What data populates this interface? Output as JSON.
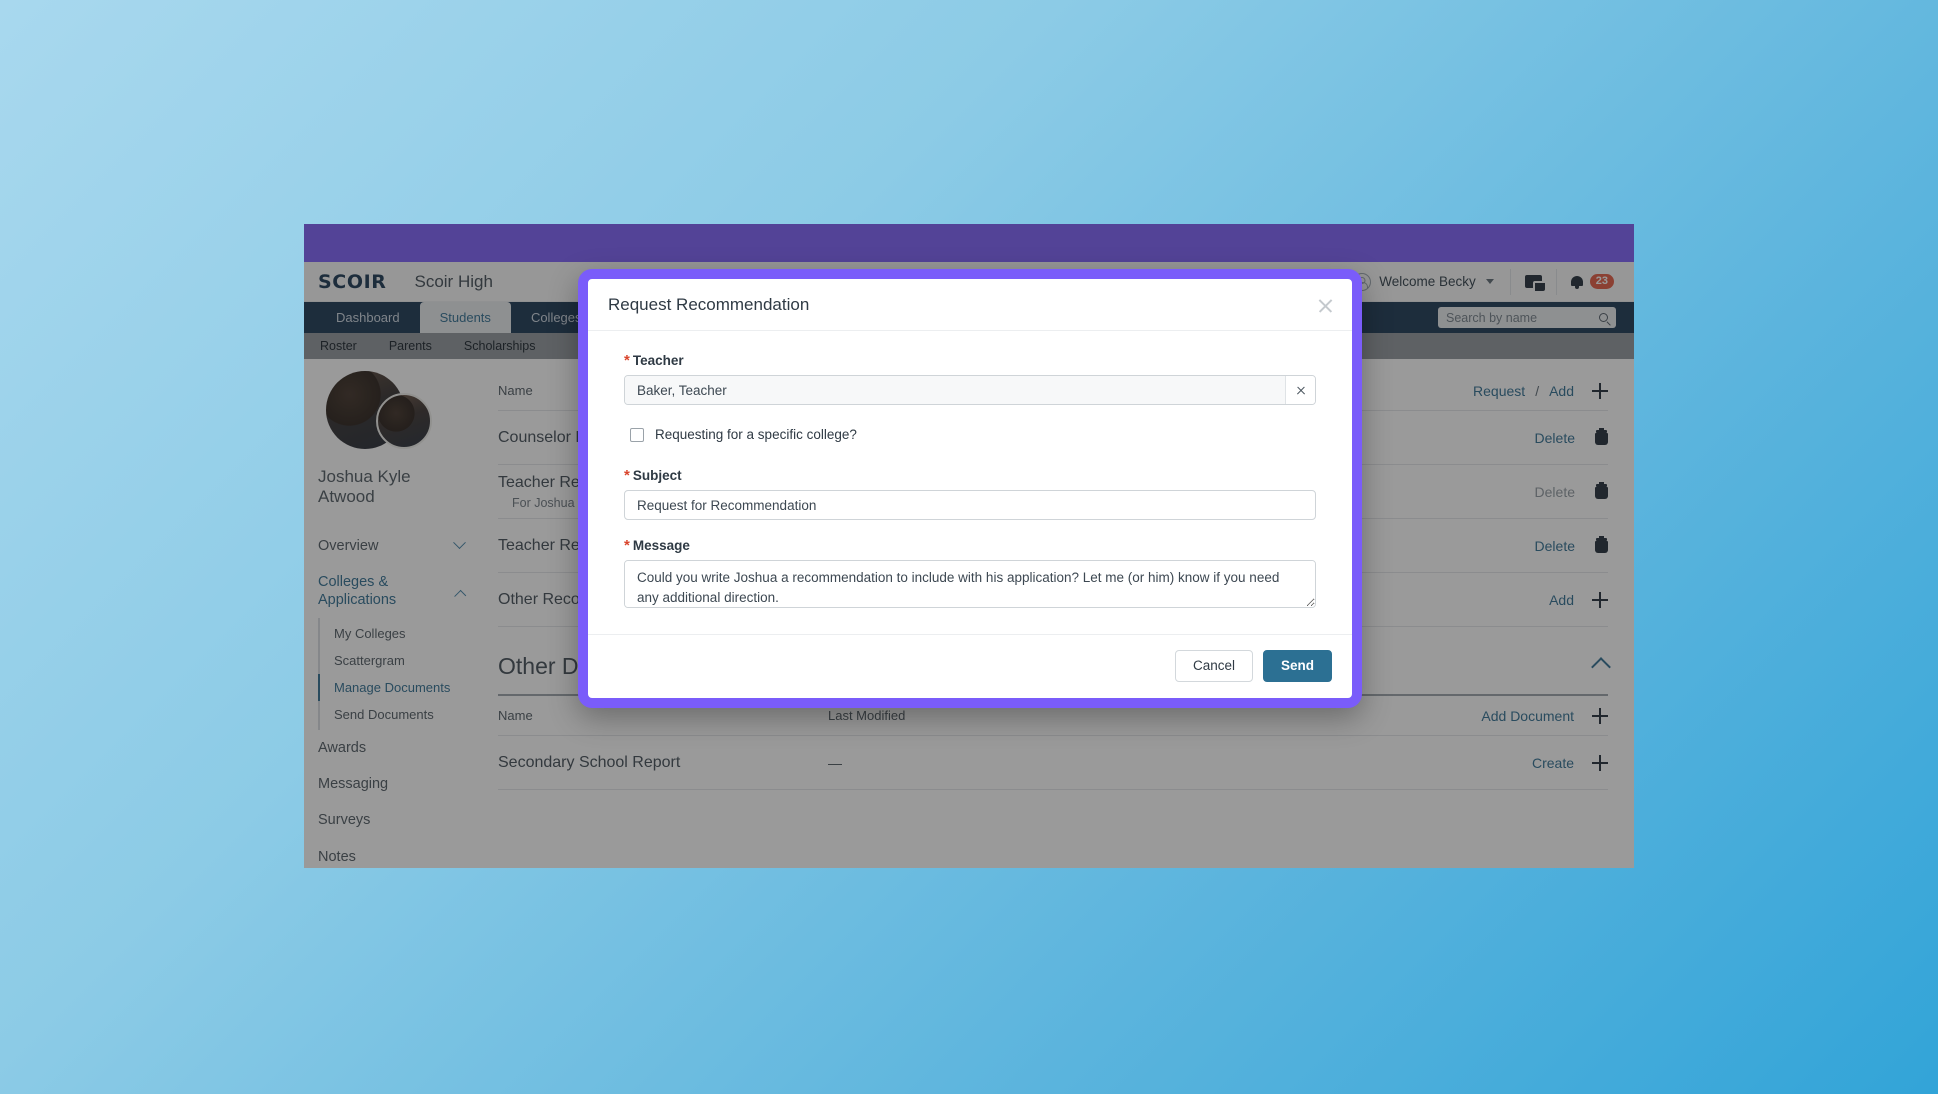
{
  "app": {
    "brand": "SCOIR",
    "school_name": "Scoir High",
    "accent_purple": "#7a5cfa",
    "accent_blue": "#2b6b8f",
    "send_button_color": "#2c7093",
    "badge_color": "#e2563d",
    "required_star_color": "#d9452c"
  },
  "header": {
    "user_label": "Welcome Becky",
    "notification_count": "23",
    "icons": {
      "user": "user-avatar-icon",
      "chevron": "chevron-down-icon",
      "messages": "chat-bubble-icon",
      "notifications": "bell-icon"
    }
  },
  "primary_nav": {
    "tabs": [
      {
        "label": "Dashboard",
        "active": false
      },
      {
        "label": "Students",
        "active": true
      },
      {
        "label": "Colleges",
        "active": false
      }
    ]
  },
  "search": {
    "placeholder": "Search by name",
    "value": "",
    "icon": "search-icon"
  },
  "secondary_nav": {
    "items": [
      "Roster",
      "Parents",
      "Scholarships"
    ]
  },
  "sidebar": {
    "student_name": "Joshua Kyle Atwood",
    "items": [
      {
        "label": "Overview",
        "expanded": false,
        "accent": false
      },
      {
        "label": "Colleges & Applications",
        "expanded": true,
        "accent": true
      }
    ],
    "sub_items": [
      {
        "label": "My Colleges",
        "selected": false
      },
      {
        "label": "Scattergram",
        "selected": false
      },
      {
        "label": "Manage Documents",
        "selected": true
      },
      {
        "label": "Send Documents",
        "selected": false
      }
    ],
    "tail_items": [
      {
        "label": "Awards"
      },
      {
        "label": "Messaging"
      },
      {
        "label": "Surveys"
      },
      {
        "label": "Notes"
      }
    ]
  },
  "recommendations_table": {
    "header": {
      "name": "Name",
      "actions": [
        "Request",
        "/",
        "Add"
      ]
    },
    "rows": [
      {
        "name": "Counselor Recommendation",
        "sub": "",
        "action": "Delete",
        "muted": false
      },
      {
        "name": "Teacher Recommendation",
        "sub": "For Joshua",
        "action": "Delete",
        "muted": true
      },
      {
        "name": "Teacher Recommendation",
        "sub": "",
        "action": "Delete",
        "muted": false
      },
      {
        "name": "Other Recommendation",
        "sub": "",
        "action": "Add",
        "muted": false
      }
    ]
  },
  "other_section": {
    "title": "Other Documents",
    "headers": {
      "name": "Name",
      "last_modified": "Last Modified",
      "action": "Add Document"
    },
    "rows": [
      {
        "name": "Secondary School Report",
        "last_modified": "—",
        "action": "Create"
      }
    ]
  },
  "modal": {
    "title": "Request Recommendation",
    "close_icon": "close-icon",
    "teacher": {
      "label": "Teacher",
      "required": true,
      "value": "Baker, Teacher",
      "clear_icon": "clear-x-icon"
    },
    "specific_college": {
      "label": "Requesting for a specific college?",
      "checked": false
    },
    "subject": {
      "label": "Subject",
      "required": true,
      "value": "Request for Recommendation"
    },
    "message": {
      "label": "Message",
      "required": true,
      "value": "Could you write Joshua a recommendation to include with his application? Let me (or him) know if you need any additional direction."
    },
    "buttons": {
      "cancel": "Cancel",
      "send": "Send"
    }
  }
}
